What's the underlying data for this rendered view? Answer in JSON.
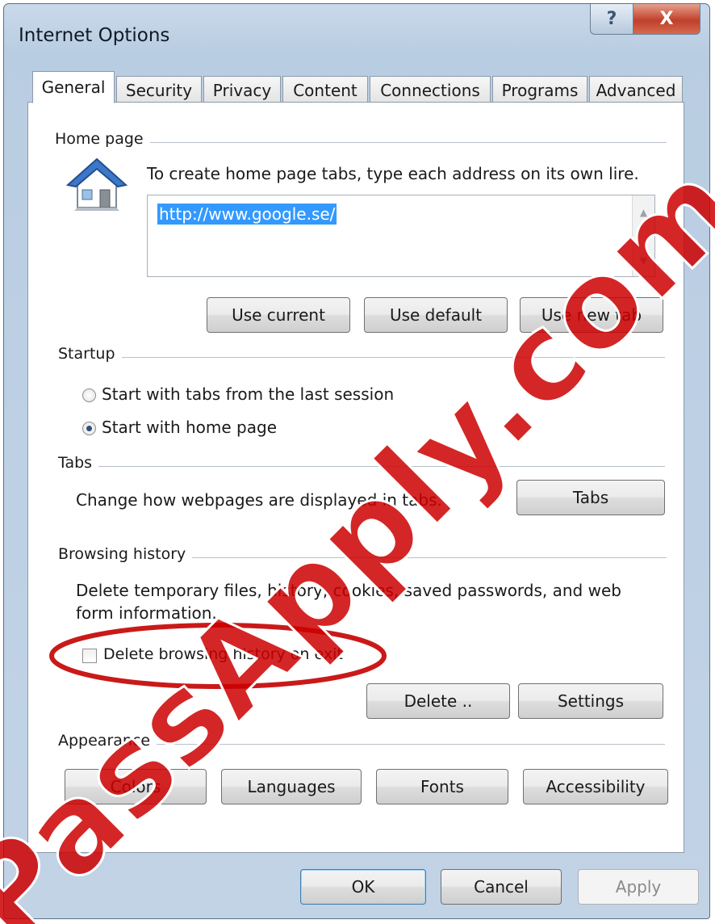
{
  "window": {
    "title": "Internet Options",
    "help_label": "?",
    "close_label": "X"
  },
  "tabs": [
    {
      "label": "General"
    },
    {
      "label": "Security"
    },
    {
      "label": "Privacy"
    },
    {
      "label": "Content"
    },
    {
      "label": "Connections"
    },
    {
      "label": "Programs"
    },
    {
      "label": "Advanced"
    }
  ],
  "home_page": {
    "group_label": "Home page",
    "instruction": "To create home page tabs, type each address on its own lire.",
    "url_value": "http://www.google.se/",
    "buttons": {
      "use_current": "Use current",
      "use_default": "Use default",
      "use_new_tab": "Use new tab"
    }
  },
  "startup": {
    "group_label": "Startup",
    "options": [
      {
        "label": "Start with tabs from the last session",
        "checked": false
      },
      {
        "label": "Start with home page",
        "checked": true
      }
    ]
  },
  "tabs_group": {
    "group_label": "Tabs",
    "description": "Change how webpages are displayed in tabs.",
    "button": "Tabs"
  },
  "browsing_history": {
    "group_label": "Browsing history",
    "description_line1": "Delete temporary files, history, cookies, saved passwords, and web",
    "description_line2": "form information.",
    "checkbox_label": "Delete browsing history on exit",
    "checkbox_checked": false,
    "buttons": {
      "delete": "Delete ..",
      "settings": "Settings"
    }
  },
  "appearance": {
    "group_label": "Appearance",
    "buttons": {
      "colors": "Colors",
      "languages": "Languages",
      "fonts": "Fonts",
      "accessibility": "Accessibility"
    }
  },
  "dialog_buttons": {
    "ok": "OK",
    "cancel": "Cancel",
    "apply": "Apply"
  },
  "watermark": {
    "text": "PassApply.com",
    "color": "#cc0000"
  },
  "colors": {
    "accent_highlight": "#3399ff",
    "annotation_ellipse": "#c40000"
  }
}
